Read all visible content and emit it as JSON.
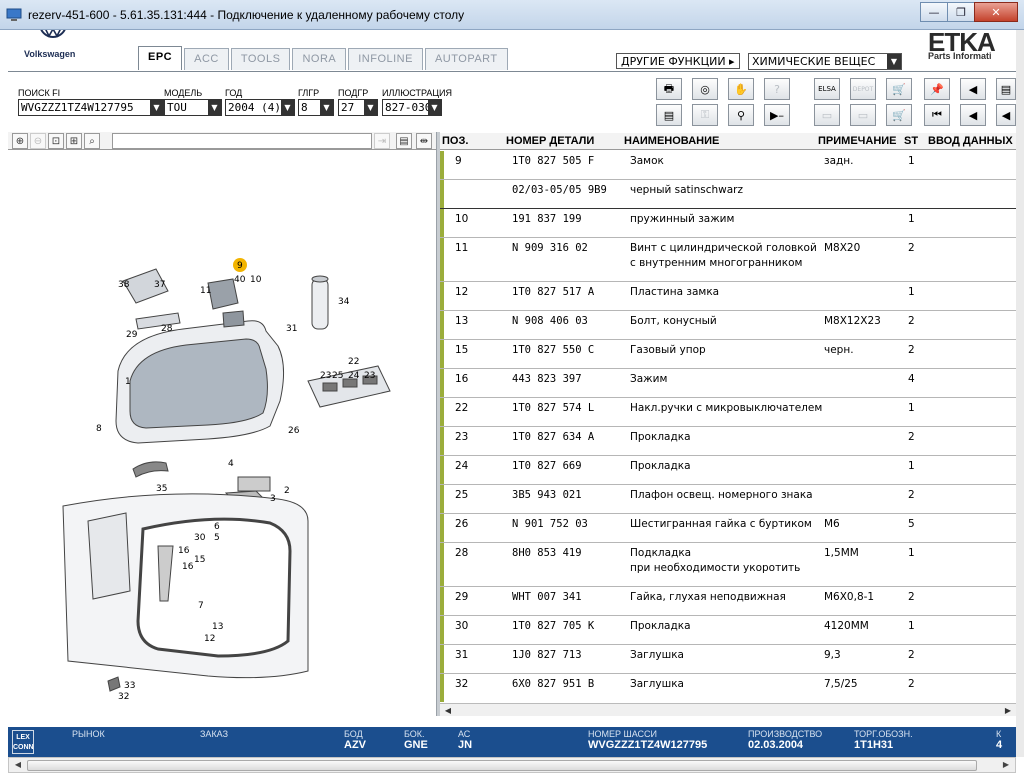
{
  "window": {
    "title": "rezerv-451-600 - 5.61.35.131:444 - Подключение к удаленному рабочему столу",
    "minimize": "—",
    "restore": "❐",
    "close": "✕"
  },
  "brand": {
    "vw": "Volkswagen",
    "etka": "ETKA",
    "etka_sub": "Parts Informati"
  },
  "tabs": [
    "EPC",
    "ACC",
    "TOOLS",
    "NORA",
    "INFOLINE",
    "AUTOPART"
  ],
  "functions": {
    "label": "ДРУГИЕ ФУНКЦИИ ▸",
    "selected": "ХИМИЧЕСКИЕ ВЕЩЕС"
  },
  "filters": {
    "search_label": "ПОИСК FI",
    "search_value": "WVGZZZ1TZ4W127795",
    "model_label": "МОДЕЛЬ",
    "model_value": "TOU",
    "year_label": "ГОД",
    "year_value": "2004 (4)",
    "group_label": "ГЛГР",
    "group_value": "8",
    "subgroup_label": "ПОДГР",
    "subgroup_value": "27",
    "illustration_label": "ИЛЛЮСТРАЦИЯ",
    "illustration_value": "827-030"
  },
  "toolbar_icons": {
    "elsa": "ELSA",
    "depot": "DEPOT"
  },
  "table": {
    "headers": {
      "pos": "ПОЗ.",
      "part": "НОМЕР ДЕТАЛИ",
      "name": "НАИМЕНОВАНИЕ",
      "note": "ПРИМЕЧАНИЕ",
      "st": "ST",
      "input": "ВВОД ДАННЫХ"
    },
    "rows": [
      {
        "pos": "9",
        "part": "1T0  827  505  F",
        "name": "Замок",
        "name2": "",
        "note": "задн.",
        "st": "1"
      },
      {
        "pos": "",
        "part": "02/03-05/05 9B9",
        "name": "черный satinschwarz",
        "name2": "",
        "note": "",
        "st": ""
      },
      {
        "pos": "10",
        "part": "191  837  199",
        "name": "пружинный зажим",
        "name2": "",
        "note": "",
        "st": "1"
      },
      {
        "pos": "11",
        "part": "N    909  316  02",
        "name": "Винт с цилиндрической головкой",
        "name2": "с внутренним многогранником",
        "note": "M8X20",
        "st": "2"
      },
      {
        "pos": "12",
        "part": "1T0  827  517  A",
        "name": "Пластина замка",
        "name2": "",
        "note": "",
        "st": "1"
      },
      {
        "pos": "13",
        "part": "N    908  406  03",
        "name": "Болт, конусный",
        "name2": "",
        "note": "M8X12X23",
        "st": "2"
      },
      {
        "pos": "15",
        "part": "1T0  827  550  C",
        "name": "Газовый упор",
        "name2": "",
        "note": "черн.",
        "st": "2"
      },
      {
        "pos": "16",
        "part": "443  823  397",
        "name": "Зажим",
        "name2": "",
        "note": "",
        "st": "4"
      },
      {
        "pos": "22",
        "part": "1T0  827  574  L",
        "name": "Накл.ручки с микровыключателем",
        "name2": "",
        "note": "",
        "st": "1"
      },
      {
        "pos": "23",
        "part": "1T0  827  634  A",
        "name": "Прокладка",
        "name2": "",
        "note": "",
        "st": "2"
      },
      {
        "pos": "24",
        "part": "1T0  827  669",
        "name": "Прокладка",
        "name2": "",
        "note": "",
        "st": "1"
      },
      {
        "pos": "25",
        "part": "3B5  943  021",
        "name": "Плафон освещ. номерного знака",
        "name2": "",
        "note": "",
        "st": "2"
      },
      {
        "pos": "26",
        "part": "N    901  752  03",
        "name": "Шестигранная гайка с буртиком",
        "name2": "",
        "note": "M6",
        "st": "5"
      },
      {
        "pos": "28",
        "part": "8H0  853  419",
        "name": "Подкладка",
        "name2": "при необходимости укоротить",
        "note": "1,5MM",
        "st": "1"
      },
      {
        "pos": "29",
        "part": "WHT  007  341",
        "name": "Гайка, глухая неподвижная",
        "name2": "",
        "note": "M6X0,8-1",
        "st": "2"
      },
      {
        "pos": "30",
        "part": "1T0  827  705  K",
        "name": "Прокладка",
        "name2": "",
        "note": "4120MM",
        "st": "1"
      },
      {
        "pos": "31",
        "part": "1J0  827  713",
        "name": "Заглушка",
        "name2": "",
        "note": "9,3",
        "st": "2"
      },
      {
        "pos": "32",
        "part": "6X0  827  951  B",
        "name": "Заглушка",
        "name2": "",
        "note": "7,5/25",
        "st": "2"
      }
    ]
  },
  "diagram_labels": [
    "9",
    "40",
    "10",
    "11",
    "38",
    "37",
    "29",
    "28",
    "34",
    "31",
    "1",
    "22",
    "23",
    "25",
    "24",
    "23",
    "8",
    "26",
    "4",
    "35",
    "3",
    "2",
    "30",
    "6",
    "5",
    "16",
    "15",
    "16",
    "7",
    "13",
    "12",
    "33",
    "32"
  ],
  "status": {
    "lex": "LEX CONN",
    "market_label": "РЫНОК",
    "market_value": "",
    "order_label": "ЗАКАЗ",
    "order_value": "",
    "bod_label": "БОД",
    "bod_value": "AZV",
    "bok_label": "БОК.",
    "bok_value": "GNE",
    "ac_label": "АС",
    "ac_value": "JN",
    "chassis_label": "НОМЕР ШАССИ",
    "chassis_value": "WVGZZZ1TZ4W127795",
    "prod_label": "ПРОИЗВОДСТВО",
    "prod_value": "02.03.2004",
    "trade_label": "ТОРГ.ОБОЗН.",
    "trade_value": "1T1H31",
    "extra_label": "К",
    "extra_value": "4"
  }
}
